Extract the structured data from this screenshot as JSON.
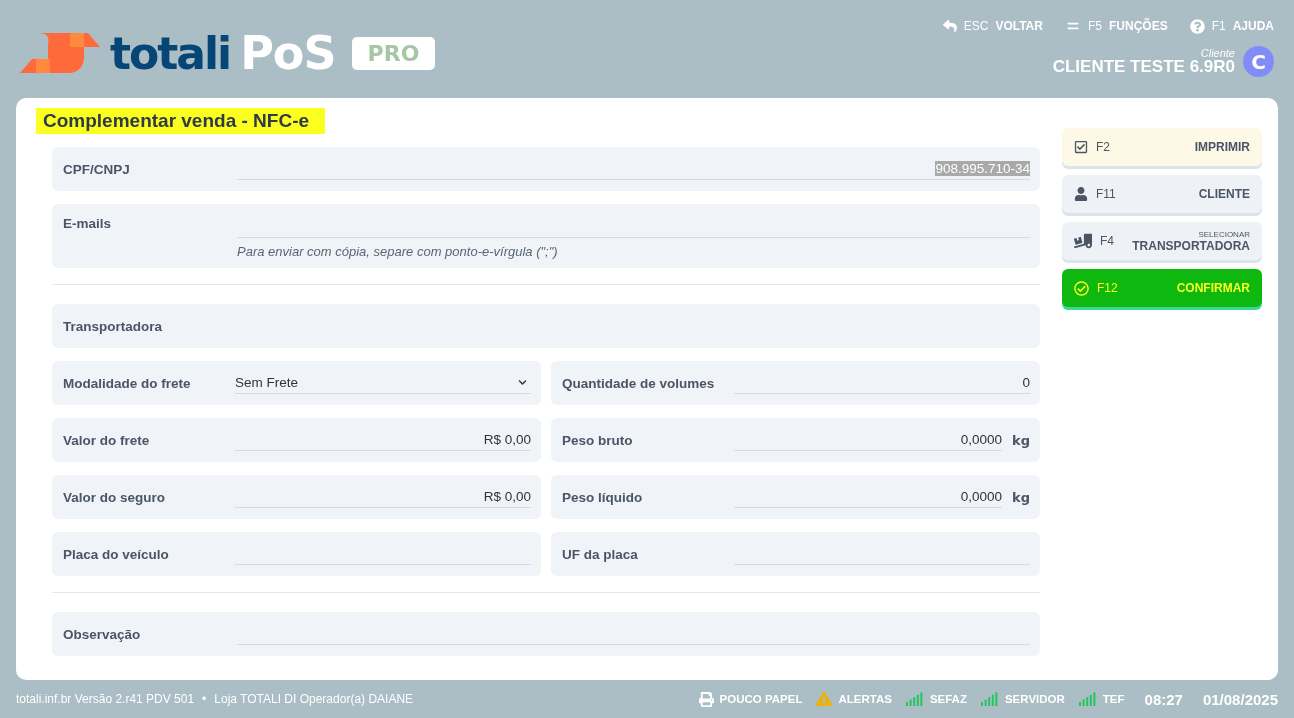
{
  "header": {
    "logo": {
      "brand": "totali",
      "product": "PoS",
      "badge": "PRO"
    },
    "shortcuts": [
      {
        "key": "ESC",
        "label": "VOLTAR"
      },
      {
        "key": "F5",
        "label": "FUNÇÕES"
      },
      {
        "key": "F1",
        "label": "AJUDA"
      }
    ],
    "client": {
      "caption": "Cliente",
      "name": "CLIENTE TESTE 6.9R0",
      "avatar": "C"
    }
  },
  "form": {
    "title": "Complementar venda - NFC-e",
    "rows": [
      {
        "kind": "fields",
        "fields": [
          {
            "kind": "text",
            "label": "CPF/CNPJ",
            "value": "908.995.710-34",
            "highlighted": true
          }
        ]
      },
      {
        "kind": "fields",
        "fields": [
          {
            "kind": "text",
            "label": "E-mails",
            "hint": "Para enviar com cópia, separe com ponto-e-vírgula (\";\")"
          }
        ]
      },
      {
        "kind": "divider"
      },
      {
        "kind": "fields",
        "fields": [
          {
            "kind": "plain",
            "label": "Transportadora"
          }
        ]
      },
      {
        "kind": "fields",
        "fields": [
          {
            "kind": "select",
            "label": "Modalidade do frete",
            "value": "Sem Frete"
          },
          {
            "kind": "text",
            "label": "Quantidade de volumes",
            "value": "0"
          }
        ]
      },
      {
        "kind": "fields",
        "fields": [
          {
            "kind": "text",
            "label": "Valor do frete",
            "value": "R$ 0,00"
          },
          {
            "kind": "text",
            "label": "Peso bruto",
            "value": "0,0000",
            "unit": "kg"
          }
        ]
      },
      {
        "kind": "fields",
        "fields": [
          {
            "kind": "text",
            "label": "Valor do seguro",
            "value": "R$ 0,00"
          },
          {
            "kind": "text",
            "label": "Peso líquido",
            "value": "0,0000",
            "unit": "kg"
          }
        ]
      },
      {
        "kind": "fields",
        "fields": [
          {
            "kind": "text",
            "label": "Placa do veículo"
          },
          {
            "kind": "text",
            "label": "UF da placa"
          }
        ]
      },
      {
        "kind": "divider"
      },
      {
        "kind": "fields",
        "fields": [
          {
            "kind": "text",
            "label": "Observação"
          }
        ]
      }
    ]
  },
  "actions": [
    {
      "kind": "highlight",
      "key": "F2",
      "label": "IMPRIMIR"
    },
    {
      "kind": "normal",
      "key": "F11",
      "label": "CLIENTE"
    },
    {
      "kind": "normal",
      "key": "F4",
      "caption": "SELECIONAR",
      "label": "TRANSPORTADORA"
    },
    {
      "kind": "confirm",
      "key": "F12",
      "label": "CONFIRMAR"
    }
  ],
  "status_bar": {
    "info": "totali.inf.br Versão 2.r41 PDV 501",
    "separator": "•",
    "store": "Loja TOTALI DI Operador(a) DAIANE",
    "indicators": [
      {
        "label": "POUCO PAPEL"
      },
      {
        "label": "ALERTAS"
      },
      {
        "label": "SEFAZ"
      },
      {
        "label": "SERVIDOR"
      },
      {
        "label": "TEF"
      }
    ],
    "time": "08:27",
    "date": "01/08/2025"
  }
}
